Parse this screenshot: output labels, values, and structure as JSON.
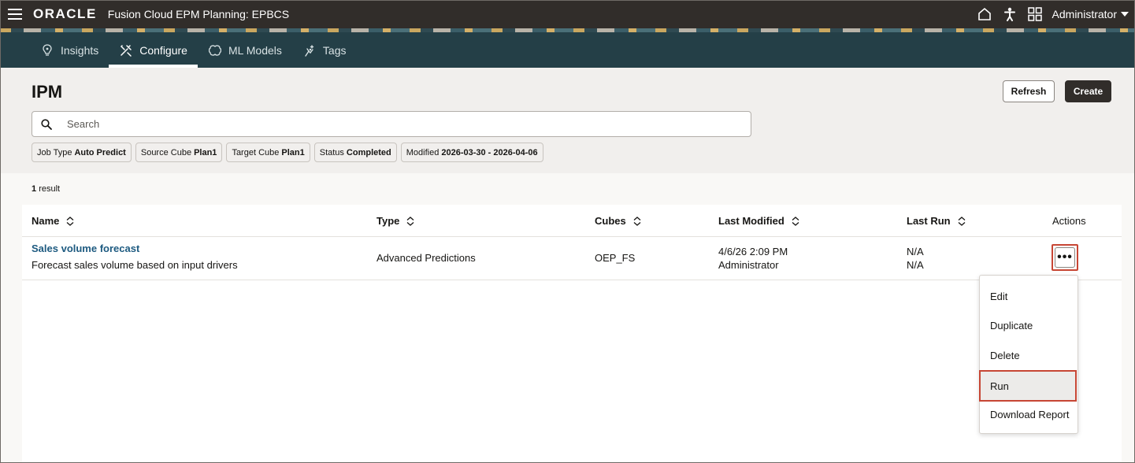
{
  "topbar": {
    "logo": "ORACLE",
    "app_title": "Fusion Cloud EPM Planning:  EPBCS",
    "user": "Administrator"
  },
  "nav": {
    "tabs": [
      {
        "label": "Insights",
        "icon": "lightbulb-pin-icon",
        "active": false
      },
      {
        "label": "Configure",
        "icon": "tools-icon",
        "active": true
      },
      {
        "label": "ML Models",
        "icon": "brain-icon",
        "active": false
      },
      {
        "label": "Tags",
        "icon": "sparkle-person-icon",
        "active": false
      }
    ]
  },
  "header": {
    "title": "IPM",
    "refresh_label": "Refresh",
    "create_label": "Create",
    "search_placeholder": "Search",
    "filters": [
      {
        "key": "Job Type",
        "value": "Auto Predict"
      },
      {
        "key": "Source Cube",
        "value": "Plan1"
      },
      {
        "key": "Target Cube",
        "value": "Plan1"
      },
      {
        "key": "Status",
        "value": "Completed"
      },
      {
        "key": "Modified",
        "value": "2026-03-30 - 2026-04-06"
      }
    ]
  },
  "results": {
    "count_num": "1",
    "count_label": "result"
  },
  "table": {
    "columns": [
      "Name",
      "Type",
      "Cubes",
      "Last Modified",
      "Last Run",
      "Actions"
    ],
    "rows": [
      {
        "name": "Sales volume forecast",
        "description": "Forecast sales volume based on input drivers",
        "type": "Advanced Predictions",
        "cubes": "OEP_FS",
        "modified_date": "4/6/26 2:09 PM",
        "modified_by": "Administrator",
        "last_run_1": "N/A",
        "last_run_2": "N/A",
        "actions_label": "•••"
      }
    ]
  },
  "menu": {
    "items": [
      "Edit",
      "Duplicate",
      "Delete",
      "Run",
      "Download Report"
    ]
  },
  "colors": {
    "topbar": "#312d2a",
    "nav": "#243f47",
    "highlight": "#c74634",
    "link": "#1d5a80"
  }
}
